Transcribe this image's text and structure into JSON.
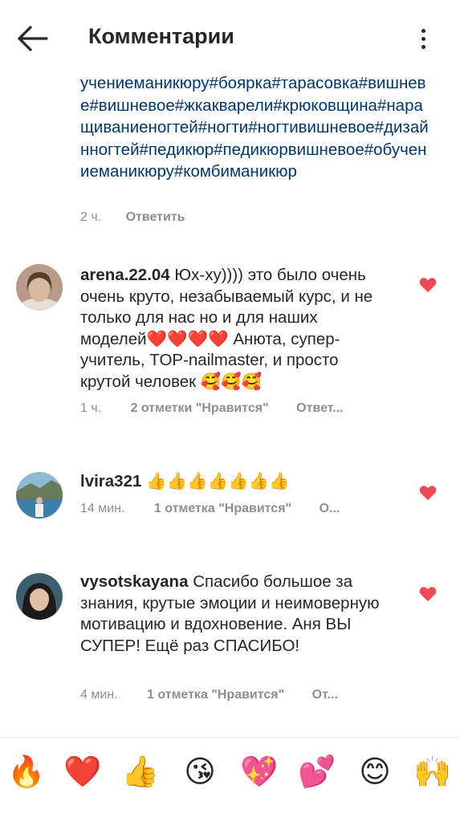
{
  "header": {
    "title": "Комментарии",
    "back_icon": "arrow-left-icon",
    "more_icon": "more-vertical-icon"
  },
  "caption": {
    "text": "учениеманикюру#боярка#тарасовка#вишневе#вишневое#жкакварели#крюковщина#наращиваниеногтей#ногти#ногтивишневое#дизайнногтей#педикюр#педикюрвишневое#обучениеманикюру#комбиманикюр",
    "time": "2 ч.",
    "reply": "Ответить"
  },
  "comments": [
    {
      "username": "arena.22.04",
      "text": "Юх-ху)))) это было очень очень круто, незабываемый курс, и не только для нас но и для наших моделей",
      "hearts": "❤️❤️❤️❤️",
      "text2": "Анюта, супер-учитель, TOP-nailmaster, и просто крутой человек",
      "emojis": "🥰🥰🥰",
      "time": "1 ч.",
      "likes": "2 отметки \"Нравится\"",
      "reply": "Ответ..."
    },
    {
      "username": "lvira321",
      "text": "",
      "emojis": "👍👍👍👍👍👍👍",
      "time": "14 мин.",
      "likes": "1 отметка \"Нравится\"",
      "reply": "О..."
    },
    {
      "username": "vysotskayana",
      "text": "Спасибо большое за знания, крутые эмоции и неимоверную мотивацию и вдохновение. Аня ВЫ СУПЕР! Ещё раз СПАСИБО!",
      "time": "4 мин.",
      "likes": "1 отметка \"Нравится\"",
      "reply": "От..."
    }
  ],
  "emoji_bar": [
    "🔥",
    "❤️",
    "👍",
    "😘",
    "💖",
    "💕",
    "😊",
    "🙌"
  ],
  "colors": {
    "hashtag": "#00376b",
    "heart": "#ed4956",
    "meta": "#8e8e8e",
    "text": "#262626"
  }
}
